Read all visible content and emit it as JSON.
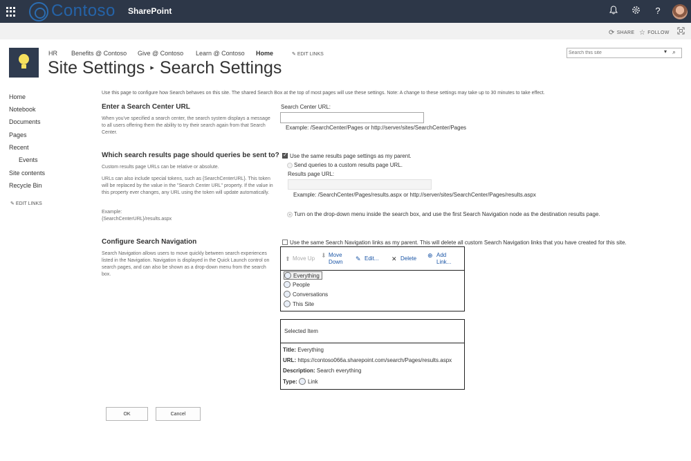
{
  "suite": {
    "brand": "Contoso",
    "app": "SharePoint",
    "icons": [
      "waffle-icon",
      "bell-icon",
      "gear-icon",
      "help-icon",
      "avatar"
    ]
  },
  "ribbon": {
    "share": "SHARE",
    "follow": "FOLLOW"
  },
  "topnav": {
    "items": [
      "HR",
      "Benefits @ Contoso",
      "Give @ Contoso",
      "Learn @ Contoso",
      "Home"
    ],
    "edit_links": "EDIT LINKS"
  },
  "search": {
    "placeholder": "Search this site"
  },
  "title": {
    "parent": "Site Settings",
    "current": "Search Settings"
  },
  "leftnav": {
    "items": [
      "Home",
      "Notebook",
      "Documents",
      "Pages",
      "Recent",
      "Events",
      "Site contents",
      "Recycle Bin"
    ],
    "edit_links": "EDIT LINKS"
  },
  "page_description": "Use this page to configure how Search behaves on this site. The shared Search Box at the top of most pages will use these settings. Note: A change to these settings may take up to 30 minutes to take effect.",
  "center": {
    "title": "Enter a Search Center URL",
    "desc": "When you've specified a search center, the search system displays a message to all users offering them the ability to try their search again from that Search Center.",
    "field_label": "Search Center URL:",
    "value": "",
    "example": "Example: /SearchCenter/Pages or http://server/sites/SearchCenter/Pages"
  },
  "results": {
    "title": "Which search results page should queries be sent to?",
    "desc1": "Custom results page URLs can be relative or absolute.",
    "desc2": "URLs can also include special tokens, such as {SearchCenterURL}. This token will be replaced by the value in the \"Search Center URL\" property. If the value in this property ever changes, any URL using the token will update automatically.",
    "desc3a": "Example:",
    "desc3b": "{SearchCenterURL}/results.aspx",
    "use_parent": "Use the same results page settings as my parent.",
    "custom": "Send queries to a custom results page URL.",
    "url_label": "Results page URL:",
    "example": "Example: /SearchCenter/Pages/results.aspx or http://server/sites/SearchCenter/Pages/results.aspx",
    "dropdown_option": "Turn on the drop-down menu inside the search box, and use the first Search Navigation node as the destination results page."
  },
  "navigation": {
    "title": "Configure Search Navigation",
    "desc": "Search Navigation allows users to move quickly between search experiences listed in the Navigation. Navigation is displayed in the Quick Launch control on search pages, and can also be shown as a drop-down menu from the search box.",
    "use_parent": "Use the same Search Navigation links as my parent. This will delete all custom Search Navigation links that you have created for this site.",
    "toolbar": {
      "move_up": "Move Up",
      "move_down_1": "Move",
      "move_down_2": "Down",
      "edit": "Edit...",
      "delete": "Delete",
      "add_1": "Add",
      "add_2": "Link..."
    },
    "nodes": [
      "Everything",
      "People",
      "Conversations",
      "This Site"
    ],
    "selected_header": "Selected Item",
    "props": {
      "title_label": "Title:",
      "title": "Everything",
      "url_label": "URL:",
      "url": "https://contoso066a.sharepoint.com/search/Pages/results.aspx",
      "desc_label": "Description:",
      "desc": "Search everything",
      "type_label": "Type:",
      "type": "Link"
    }
  },
  "buttons": {
    "ok": "OK",
    "cancel": "Cancel"
  }
}
